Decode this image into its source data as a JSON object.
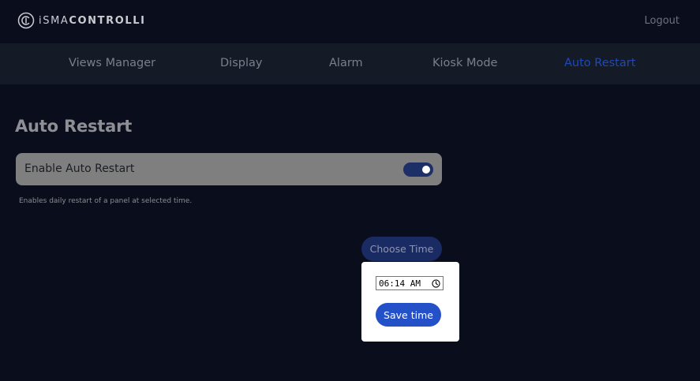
{
  "header": {
    "logo_light": "iSMA",
    "logo_bold": "CONTROLLI",
    "logout_label": "Logout"
  },
  "nav": {
    "items": [
      {
        "label": "Views Manager"
      },
      {
        "label": "Display"
      },
      {
        "label": "Alarm"
      },
      {
        "label": "Kiosk Mode"
      },
      {
        "label": "Auto Restart"
      }
    ],
    "active_index": 4
  },
  "page": {
    "title": "Auto Restart",
    "setting_label": "Enable Auto Restart",
    "setting_enabled": true,
    "setting_description": "Enables daily restart of a panel at selected time.",
    "choose_time_label": "Choose Time"
  },
  "time_popup": {
    "time_value": "06:14 AM",
    "save_label": "Save time"
  },
  "icons": {
    "logo": "ismacontrolli-logo-icon",
    "toggle": "toggle-switch",
    "clock": "clock-icon"
  },
  "colors": {
    "background": "#0a0d1c",
    "nav_background": "#151a27",
    "active_nav": "#1e49b8",
    "setting_row": "#7f7f80",
    "toggle_on": "#1c2f67",
    "primary_button": "#2450c8"
  }
}
